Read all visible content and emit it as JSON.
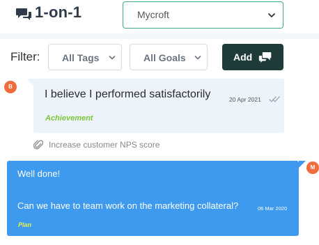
{
  "header": {
    "title": "1-on-1",
    "title_icon": "chat-bubbles-icon",
    "user_select": {
      "value": "Mycroft"
    }
  },
  "filter": {
    "label": "Filter:",
    "tags_value": "All Tags",
    "goals_value": "All Goals",
    "add_label": "Add",
    "add_icon": "chat-bubbles-icon"
  },
  "messages": [
    {
      "avatar": "B",
      "text": "I believe I performed satisfactorily",
      "date": "20 Apr 2021",
      "tag": "Achievement",
      "goal": "Increase customer NPS score",
      "status_icon": "double-check-icon"
    },
    {
      "avatar": "M",
      "line1": "Well done!",
      "line2": "Can we have to team work on the marketing collateral?",
      "date": "06 Mar 2020",
      "tag": "Plan"
    }
  ],
  "colors": {
    "accent": "#3fa58f",
    "add_button": "#1f3b39",
    "avatar": "#f26b3b",
    "incoming_bubble": "#edf3fb",
    "outgoing_bubble": "#3d9aee",
    "achievement_tag": "#7cc63a",
    "plan_tag": "#e8f04a"
  }
}
